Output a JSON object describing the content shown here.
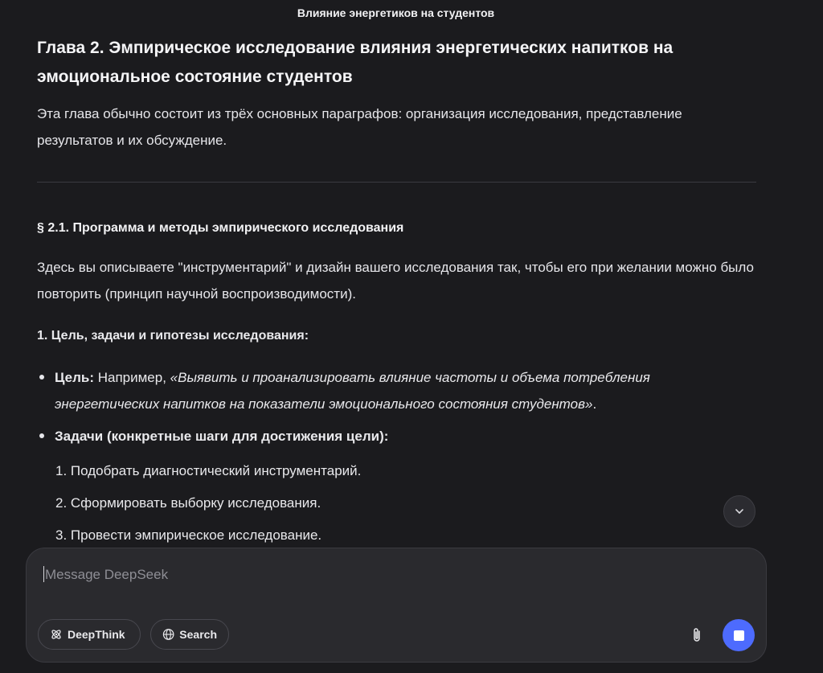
{
  "header": {
    "chat_title": "Влияние энергетиков на студентов"
  },
  "message": {
    "heading": "Глава 2. Эмпирическое исследование влияния энергетических напитков на эмоциональное состояние студентов",
    "intro": "Эта глава обычно состоит из трёх основных параграфов: организация исследования, представление результатов и их обсуждение.",
    "section_title": "§ 2.1. Программа и методы эмпирического исследования",
    "section_text": "Здесь вы описываете \"инструментарий\" и дизайн вашего исследования так, чтобы его при желании можно было повторить (принцип научной воспроизводимости).",
    "subheading": "1. Цель, задачи и гипотезы исследования:",
    "goal_label": "Цель:",
    "goal_prefix": " Например, ",
    "goal_text": "«Выявить и проанализировать влияние частоты и объема потребления энергетических напитков на показатели эмоционального состояния студентов»",
    "goal_suffix": ".",
    "tasks_label": "Задачи (конкретные шаги для достижения цели):",
    "tasks": [
      "1. Подобрать диагностический инструментарий.",
      "2. Сформировать выборку исследования.",
      "3. Провести эмпирическое исследование."
    ]
  },
  "composer": {
    "placeholder": "Message DeepSeek",
    "deepthink_label": "DeepThink",
    "search_label": "Search"
  },
  "icons": {
    "scroll": "chevron-down-icon",
    "deepthink": "atom-icon",
    "search": "globe-icon",
    "attach": "paperclip-icon",
    "send": "stop-icon"
  },
  "colors": {
    "background": "#1b1b1e",
    "composer": "#2a2a2e",
    "accent": "#4d6bfe"
  }
}
